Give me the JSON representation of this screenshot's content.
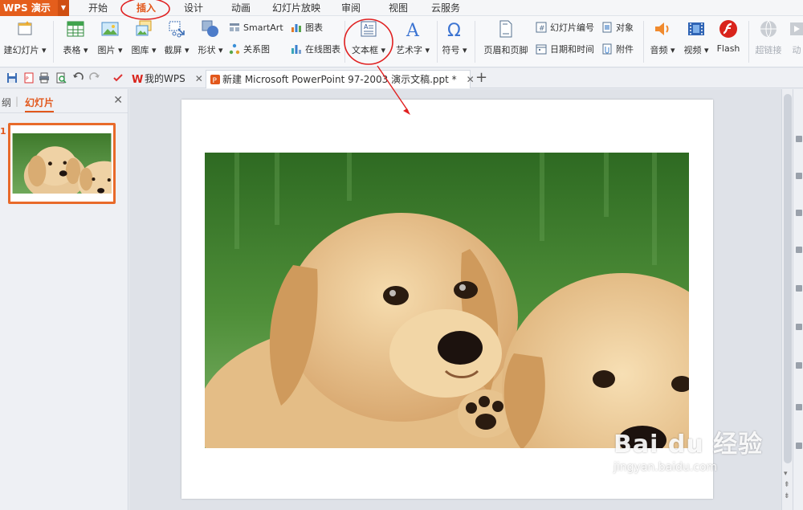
{
  "app": {
    "name": "WPS 演示"
  },
  "menu_tabs": [
    "开始",
    "插入",
    "设计",
    "动画",
    "幻灯片放映",
    "审阅",
    "视图",
    "云服务"
  ],
  "ribbon": {
    "new_slide": "建幻灯片",
    "table": "表格",
    "picture": "图片",
    "gallery": "图库",
    "screenshot": "截屏",
    "shape": "形状",
    "smartart": "SmartArt",
    "chart": "图表",
    "relation": "关系图",
    "online_chart": "在线图表",
    "textbox": "文本框",
    "wordart": "艺术字",
    "symbol": "符号",
    "header_footer": "页眉和页脚",
    "slide_number": "幻灯片编号",
    "object": "对象",
    "datetime": "日期和时间",
    "attachment": "附件",
    "audio": "音频",
    "video": "视频",
    "flash": "Flash",
    "hyperlink": "超链接",
    "motion": "动"
  },
  "doc_tabs": [
    {
      "label": "我的WPS"
    },
    {
      "label": "新建 Microsoft PowerPoint 97-2003 演示文稿.ppt *"
    }
  ],
  "left_panel": {
    "outline_tab": "纲",
    "slides_tab": "幻灯片",
    "slide_number": "1"
  },
  "watermark": {
    "brand": "Bai du 经验",
    "url": "jingyan.baidu.com"
  },
  "colors": {
    "accent": "#e2571b",
    "app_button": "#e45e1c",
    "annotation": "#e02020"
  }
}
